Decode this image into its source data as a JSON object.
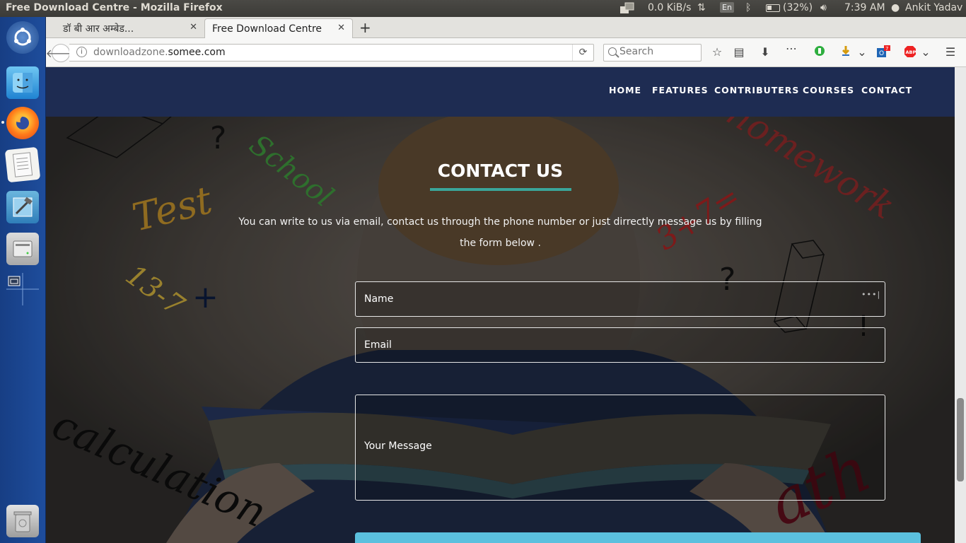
{
  "system_panel": {
    "window_title": "Free Download Centre - Mozilla Firefox",
    "net_speed": "0.0 KiB/s",
    "keyboard_layout": "En",
    "battery": "(32%)",
    "time": "7:39 AM",
    "user": "Ankit Yadav"
  },
  "browser": {
    "tabs": [
      {
        "label": "डॉ बी आर अम्बेड..."
      },
      {
        "label": "Free Download Centre"
      }
    ],
    "url_domain_prefix": "downloadzone.",
    "url_domain_main": "somee.com",
    "search_placeholder": "Search",
    "notification_badge": "7"
  },
  "site": {
    "nav": {
      "home": "HOME",
      "features": "FEATURES",
      "contributers": "CONTRIBUTERS",
      "courses": "COURSES",
      "contact": "CONTACT"
    },
    "contact": {
      "title": "CONTACT US",
      "description": "You can write to us via email, contact us through the phone number or just dirrectly message us by filling the form below .",
      "name_placeholder": "Name",
      "email_placeholder": "Email",
      "message_placeholder": "Your Message"
    },
    "background_words": {
      "school": "School",
      "test": "Test",
      "homework": "homework",
      "calculation": "calculation",
      "eq1": "3+7=",
      "eq2": "13-7",
      "q": "?",
      "plus": "+",
      "excl": "!",
      "math": "ath"
    }
  },
  "colors": {
    "nav_bg": "#1e2c52",
    "underline": "#3aa69a",
    "submit": "#5bc0de",
    "launcher": "#1e4d9c"
  }
}
